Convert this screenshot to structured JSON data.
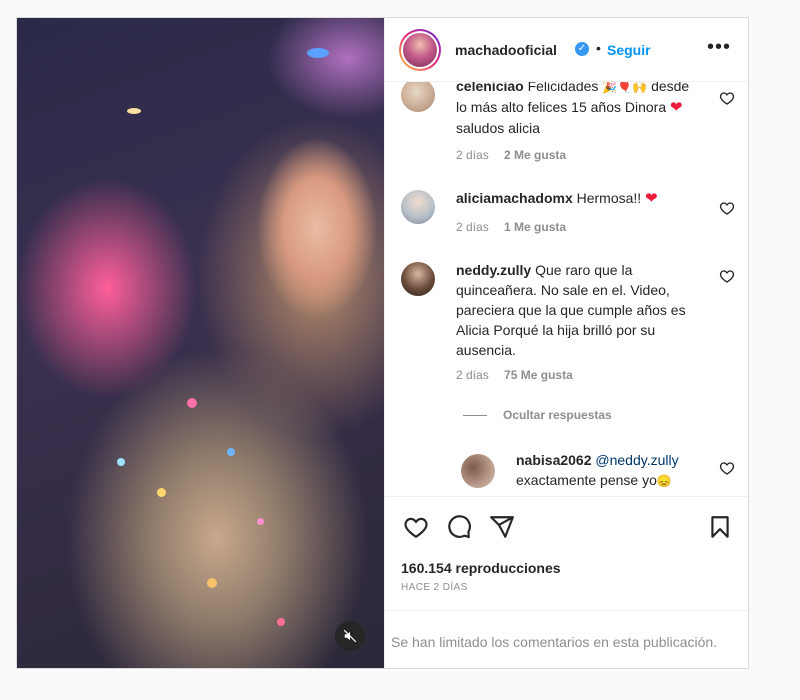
{
  "header": {
    "username": "machadooficial",
    "verified_mark": "✓",
    "separator": "•",
    "follow_label": "Seguir",
    "more_label": "•••"
  },
  "comments": [
    {
      "user": "celeniciao",
      "text_parts": [
        "Felicidades",
        "desde lo más alto felices 15 años Dinora",
        "saludos alicia"
      ],
      "emojis": [
        "🎉",
        "🎈",
        "🙌"
      ],
      "heart": "❤",
      "time": "2 días",
      "likes": "2 Me gusta"
    },
    {
      "user": "aliciamachadomx",
      "text": "Hermosa!!",
      "heart": "❤",
      "time": "2 días",
      "likes": "1 Me gusta"
    },
    {
      "user": "neddy.zully",
      "text": "Que raro que la quinceañera. No sale en el. Video, pareciera que la que cumple años es Alicia Porqué la hija brilló por su ausencia.",
      "time": "2 días",
      "likes": "75 Me gusta"
    }
  ],
  "hide_replies_label": "Ocultar respuestas",
  "reply": {
    "user": "nabisa2062",
    "mention": "@neddy.zully",
    "text": "exactamente pense yo",
    "emoji": "😞"
  },
  "stats": {
    "views": "160.154 reproducciones",
    "date": "HACE 2 DÍAS"
  },
  "limited_comments": "Se han limitado los comentarios en esta publicación.",
  "icons": [
    "heart-icon",
    "comment-icon",
    "share-icon",
    "bookmark-icon",
    "mute-icon",
    "verified-icon",
    "more-icon"
  ],
  "colors": {
    "link": "#0095f6",
    "verified": "#3897f0",
    "muted": "#8e8e8e",
    "text": "#262626"
  }
}
